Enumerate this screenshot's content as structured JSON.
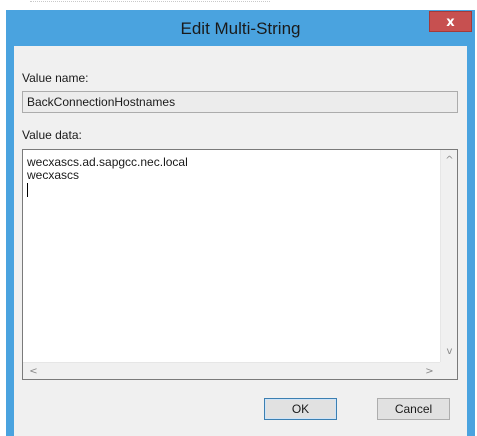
{
  "window": {
    "title": "Edit Multi-String",
    "close_glyph": "x"
  },
  "value_name": {
    "label": "Value name:",
    "value": "BackConnectionHostnames"
  },
  "value_data": {
    "label": "Value data:",
    "lines": [
      "wecxascs.ad.sapgcc.nec.local",
      "wecxascs"
    ]
  },
  "scrollbars": {
    "up": "^",
    "down": "v",
    "left": "<",
    "right": ">"
  },
  "buttons": {
    "ok": "OK",
    "cancel": "Cancel"
  },
  "colors": {
    "title_bar": "#4aa3df",
    "close_button": "#c75050",
    "client_bg": "#f0f0f0"
  }
}
